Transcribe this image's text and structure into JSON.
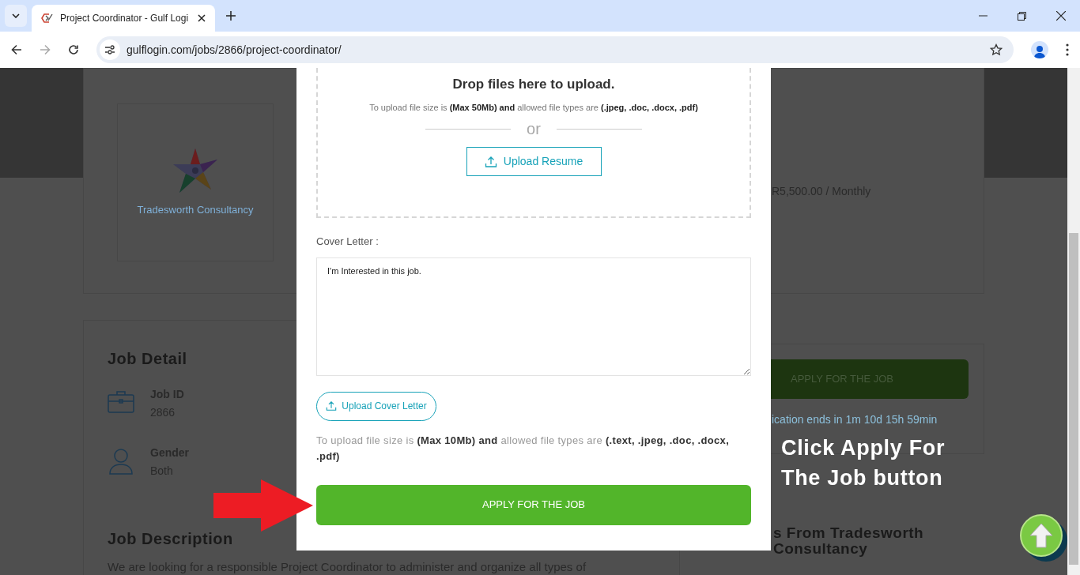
{
  "browser": {
    "tab_title": "Project Coordinator - Gulf Logi",
    "url": "gulflogin.com/jobs/2866/project-coordinator/"
  },
  "page": {
    "company_name": "Tradesworth Consultancy",
    "salary": "R5,500.00 / Monthly",
    "job_detail": {
      "title": "Job Detail",
      "items": [
        {
          "kind": "briefcase",
          "label": "Job ID",
          "value": "2866"
        },
        {
          "kind": "person",
          "label": "Gender",
          "value": "Both"
        }
      ]
    },
    "job_description": {
      "title": "Job Description",
      "text": "We are looking for a responsible Project Coordinator to administer and organize all types of"
    },
    "sidebar": {
      "apply_button": "APPLY FOR THE JOB",
      "deadline": "ication ends in 1m 10d 15h 59min"
    },
    "related_heading": "s From Tradesworth Consultancy"
  },
  "modal": {
    "drop_title": "Drop files here to upload.",
    "drop_note": "To upload file size is **(Max 50Mb) and** allowed file types are **(.jpeg, .doc, .docx, .pdf)**",
    "divider_text": "or",
    "upload_resume": "Upload Resume",
    "cover_letter_label": "Cover Letter :",
    "cover_letter_value": "I'm Interested in this job.",
    "upload_cover_letter": "Upload Cover Letter",
    "cover_note": "To upload file size is **(Max 10Mb) and** allowed file types are **(.text, .jpeg, .doc, .docx, .pdf)**",
    "apply_button": "APPLY FOR THE JOB"
  },
  "annotation": {
    "caption": "Click Apply For The Job button"
  }
}
